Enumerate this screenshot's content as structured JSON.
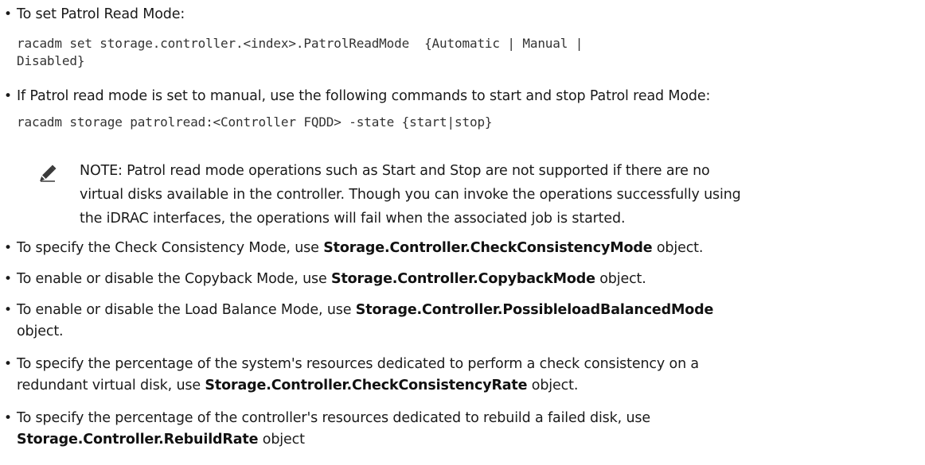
{
  "bullets": {
    "patrol_mode": {
      "text": "To set Patrol Read Mode:",
      "code_line1": "racadm set storage.controller.<index>.PatrolReadMode  {Automatic | Manual |",
      "code_line2": "Disabled}"
    },
    "patrol_manual": {
      "text": "If Patrol read mode is set to manual, use the following commands to start and stop Patrol read Mode:",
      "code": "racadm storage patrolread:<Controller FQDD> -state {start|stop}"
    },
    "check_mode": {
      "pre": "To specify the Check Consistency Mode, use ",
      "obj": "Storage.Controller.CheckConsistencyMode",
      "post": " object."
    },
    "copyback": {
      "pre": "To enable or disable the Copyback Mode, use ",
      "obj": "Storage.Controller.CopybackMode",
      "post": " object."
    },
    "load_balance": {
      "pre": "To enable or disable the Load Balance Mode, use ",
      "obj": "Storage.Controller.PossibleloadBalancedMode",
      "line2": "object."
    },
    "check_rate": {
      "line1": "To specify the percentage of the system's resources dedicated to perform a check consistency on a",
      "pre2": "redundant virtual disk, use ",
      "obj": "Storage.Controller.CheckConsistencyRate",
      "post": " object."
    },
    "rebuild_rate": {
      "line1": "To specify the percentage of the controller's resources dedicated to rebuild a failed disk, use",
      "obj": "Storage.Controller.RebuildRate",
      "post": " object"
    }
  },
  "note": {
    "label": "NOTE:",
    "line1": " Patrol read mode operations such as Start and Stop are not supported if there are no",
    "line2": "virtual disks available in the controller. Though you can invoke the operations successfully using",
    "line3": "the iDRAC interfaces, the operations will fail when the associated job is started.",
    "icon": "pencil-note-icon"
  },
  "bullet_glyph": "•"
}
